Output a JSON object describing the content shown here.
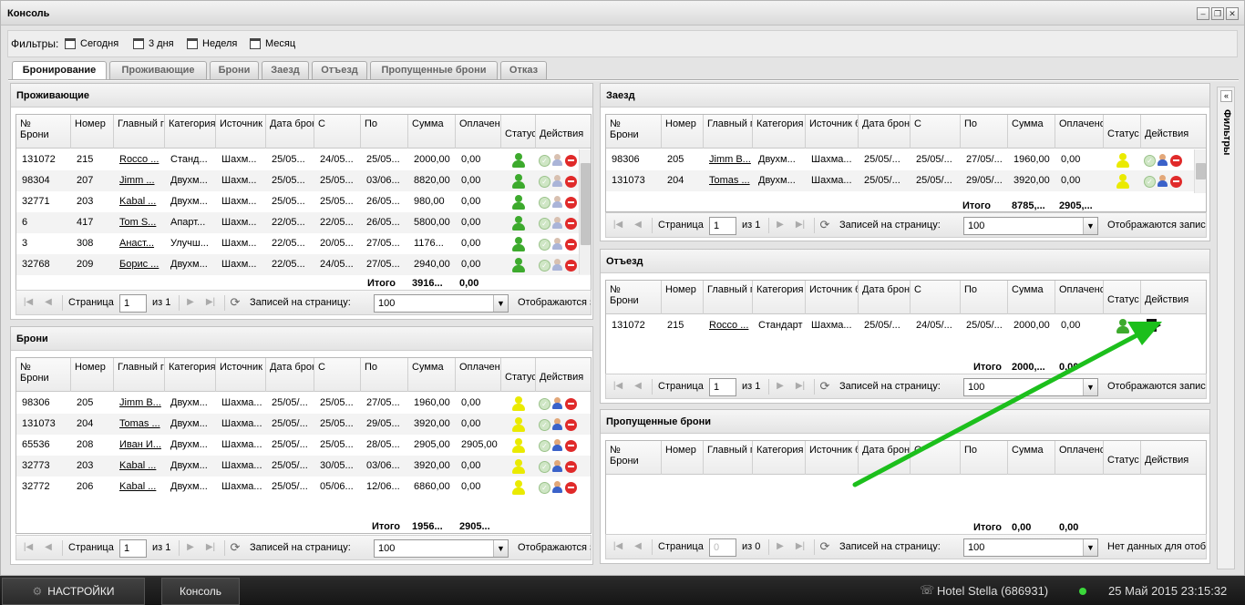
{
  "window": {
    "title": "Консоль"
  },
  "filters": {
    "label": "Фильтры:",
    "items": [
      "Сегодня",
      "3 дня",
      "Неделя",
      "Месяц"
    ]
  },
  "tabs": [
    "Бронирование",
    "Проживающие",
    "Брони",
    "Заезд",
    "Отъезд",
    "Пропущенные брони",
    "Отказ"
  ],
  "colors": {
    "accent_arrow": "#1cbf1c",
    "status_green": "#3daa2d",
    "status_yellow": "#eaea00",
    "delete_red": "#e02a2a"
  },
  "columns": {
    "num": "№\nБрони",
    "room": "Номер",
    "guest": "Главный гость",
    "category": "Категория",
    "source": "Источник бронирования",
    "date": "Дата бронирования",
    "from": "С",
    "to": "По",
    "sum": "Сумма",
    "paid": "Оплачено",
    "status": "Статус",
    "actions": "Действия"
  },
  "pager": {
    "page": "Страница",
    "of": "из 1",
    "of0": "из 0",
    "per_page": "Записей на страницу:",
    "per_value": "100",
    "page_value": "1",
    "page_value_empty": "0",
    "showing": "Отображаются записи",
    "no_data": "Нет данных для отображения"
  },
  "total_label": "Итого",
  "residents": {
    "title": "Проживающие",
    "rows": [
      [
        "131072",
        "215",
        "Rocco ...",
        "Станд...",
        "Шахм...",
        "25/05...",
        "24/05...",
        "25/05...",
        "2000,00",
        "0,00"
      ],
      [
        "98304",
        "207",
        "Jimm ...",
        "Двухм...",
        "Шахм...",
        "25/05...",
        "25/05...",
        "03/06...",
        "8820,00",
        "0,00"
      ],
      [
        "32771",
        "203",
        "Kabal ...",
        "Двухм...",
        "Шахм...",
        "25/05...",
        "25/05...",
        "26/05...",
        "980,00",
        "0,00"
      ],
      [
        "6",
        "417",
        "Tom S...",
        "Апарт...",
        "Шахм...",
        "22/05...",
        "22/05...",
        "26/05...",
        "5800,00",
        "0,00"
      ],
      [
        "3",
        "308",
        "Анаст...",
        "Улучш...",
        "Шахм...",
        "22/05...",
        "20/05...",
        "27/05...",
        "1176...",
        "0,00"
      ],
      [
        "32768",
        "209",
        "Борис ...",
        "Двухм...",
        "Шахм...",
        "22/05...",
        "24/05...",
        "27/05...",
        "2940,00",
        "0,00"
      ]
    ],
    "total_sum": "3916...",
    "total_paid": "0,00"
  },
  "bookings": {
    "title": "Брони",
    "rows": [
      [
        "98306",
        "205",
        "Jimm B...",
        "Двухм...",
        "Шахма...",
        "25/05/...",
        "25/05...",
        "27/05...",
        "1960,00",
        "0,00"
      ],
      [
        "131073",
        "204",
        "Tomas ...",
        "Двухм...",
        "Шахма...",
        "25/05/...",
        "25/05...",
        "29/05...",
        "3920,00",
        "0,00"
      ],
      [
        "65536",
        "208",
        "Иван И...",
        "Двухм...",
        "Шахма...",
        "25/05/...",
        "25/05...",
        "28/05...",
        "2905,00",
        "2905,00"
      ],
      [
        "32773",
        "203",
        "Kabal ...",
        "Двухм...",
        "Шахма...",
        "25/05/...",
        "30/05...",
        "03/06...",
        "3920,00",
        "0,00"
      ],
      [
        "32772",
        "206",
        "Kabal ...",
        "Двухм...",
        "Шахма...",
        "25/05/...",
        "05/06...",
        "12/06...",
        "6860,00",
        "0,00"
      ]
    ],
    "total_sum": "1956...",
    "total_paid": "2905..."
  },
  "checkin": {
    "title": "Заезд",
    "rows": [
      [
        "98306",
        "205",
        "Jimm B...",
        "Двухм...",
        "Шахма...",
        "25/05/...",
        "25/05/...",
        "27/05/...",
        "1960,00",
        "0,00"
      ],
      [
        "131073",
        "204",
        "Tomas ...",
        "Двухм...",
        "Шахма...",
        "25/05/...",
        "25/05/...",
        "29/05/...",
        "3920,00",
        "0,00"
      ]
    ],
    "total_sum": "8785,...",
    "total_paid": "2905,..."
  },
  "checkout": {
    "title": "Отъезд",
    "rows": [
      [
        "131072",
        "215",
        "Rocco ...",
        "Стандарт",
        "Шахма...",
        "25/05/...",
        "24/05/...",
        "25/05/...",
        "2000,00",
        "0,00"
      ]
    ],
    "total_sum": "2000,...",
    "total_paid": "0,00"
  },
  "missed": {
    "title": "Пропущенные брони",
    "rows": [],
    "total_sum": "0,00",
    "total_paid": "0,00"
  },
  "sidebar": {
    "label": "Фильтры"
  },
  "taskbar": {
    "settings": "НАСТРОЙКИ",
    "console": "Консоль",
    "hotel": "Hotel Stella (686931)",
    "datetime": "25 Май 2015 23:15:32"
  }
}
